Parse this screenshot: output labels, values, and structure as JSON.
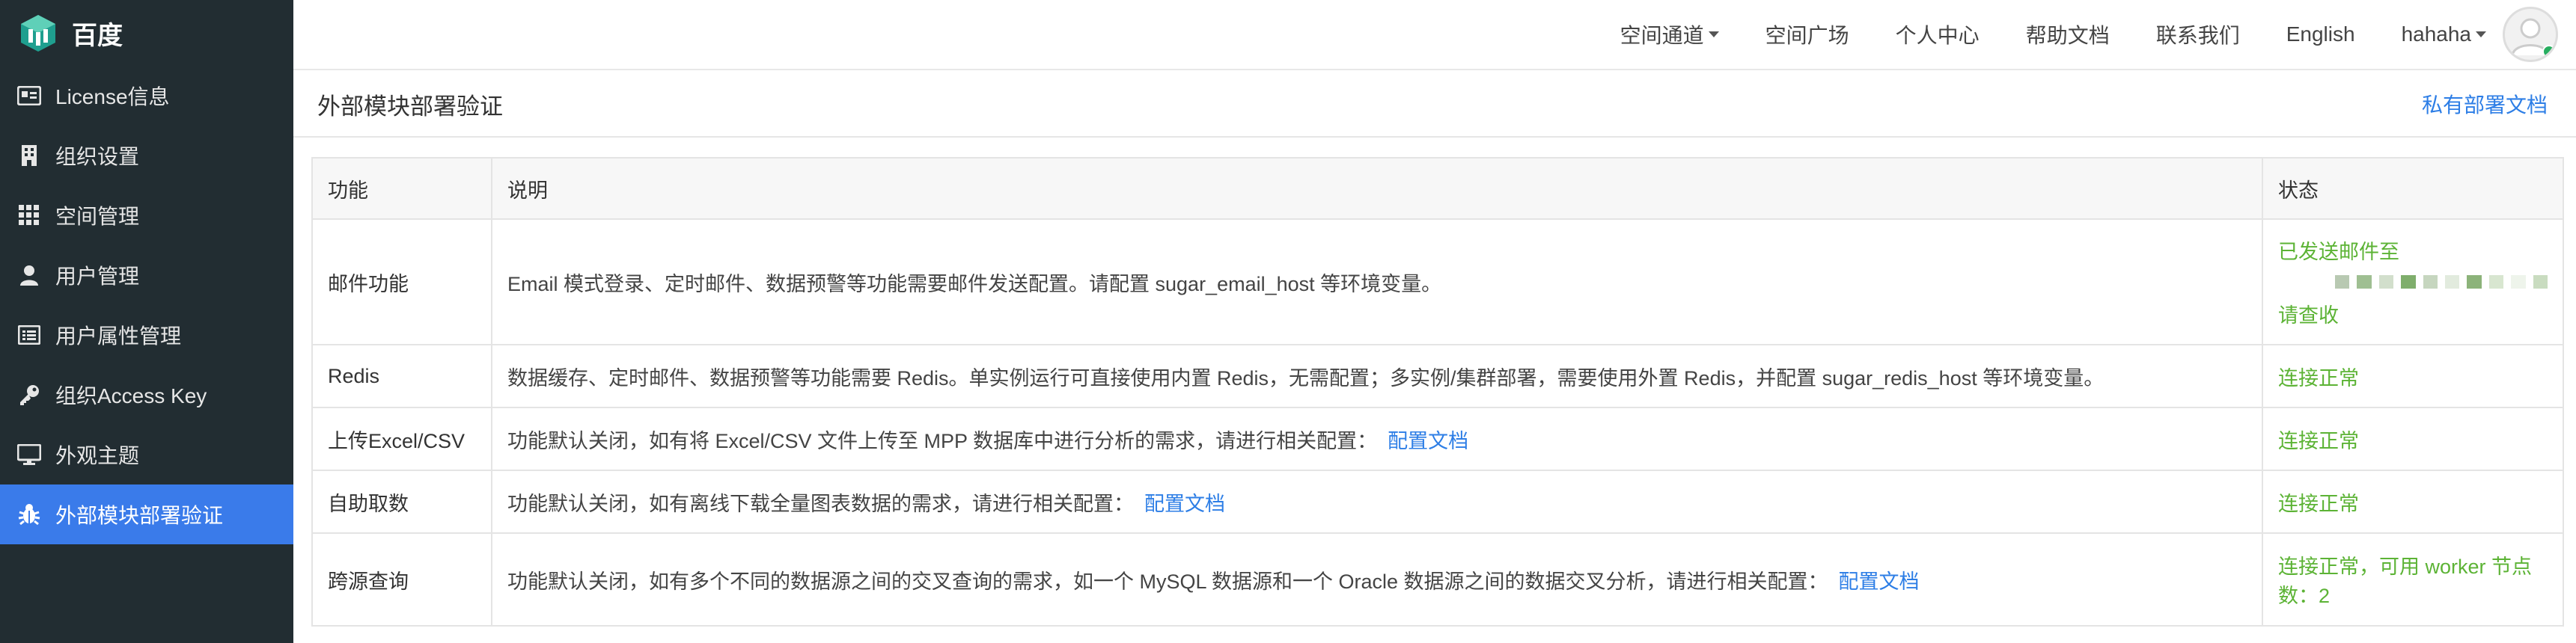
{
  "brand": {
    "name": "百度"
  },
  "sidebar": {
    "items": [
      {
        "label": "License信息",
        "icon": "id-card-icon"
      },
      {
        "label": "组织设置",
        "icon": "building-icon"
      },
      {
        "label": "空间管理",
        "icon": "grid-icon"
      },
      {
        "label": "用户管理",
        "icon": "user-icon"
      },
      {
        "label": "用户属性管理",
        "icon": "list-icon"
      },
      {
        "label": "组织Access Key",
        "icon": "key-icon"
      },
      {
        "label": "外观主题",
        "icon": "monitor-icon"
      },
      {
        "label": "外部模块部署验证",
        "icon": "bug-icon",
        "active": true
      }
    ]
  },
  "topbar": {
    "space_channel": "空间通道",
    "space_square": "空间广场",
    "personal_center": "个人中心",
    "help_docs": "帮助文档",
    "contact_us": "联系我们",
    "language": "English",
    "username": "hahaha"
  },
  "page": {
    "title": "外部模块部署验证",
    "private_deploy_link": "私有部署文档"
  },
  "table": {
    "headers": {
      "feature": "功能",
      "description": "说明",
      "status": "状态"
    },
    "rows": [
      {
        "feature": "邮件功能",
        "description": "Email 模式登录、定时邮件、数据预警等功能需要邮件发送配置。请配置 sugar_email_host 等环境变量。",
        "status_line1": "已发送邮件至",
        "status_line2": "请查收"
      },
      {
        "feature": "Redis",
        "description": "数据缓存、定时邮件、数据预警等功能需要 Redis。单实例运行可直接使用内置 Redis，无需配置；多实例/集群部署，需要使用外置 Redis，并配置 sugar_redis_host 等环境变量。",
        "status": "连接正常"
      },
      {
        "feature": "上传Excel/CSV",
        "description": "功能默认关闭，如有将 Excel/CSV 文件上传至 MPP 数据库中进行分析的需求，请进行相关配置：",
        "link": "配置文档",
        "status": "连接正常"
      },
      {
        "feature": "自助取数",
        "description": "功能默认关闭，如有离线下载全量图表数据的需求，请进行相关配置：",
        "link": "配置文档",
        "status": "连接正常"
      },
      {
        "feature": "跨源查询",
        "description": "功能默认关闭，如有多个不同的数据源之间的交叉查询的需求，如一个 MySQL 数据源和一个 Oracle 数据源之间的数据交叉分析，请进行相关配置：",
        "link": "配置文档",
        "status": "连接正常，可用 worker 节点数：2"
      }
    ]
  },
  "colors": {
    "sidebar_bg": "#222d32",
    "active_bg": "#3a7bea",
    "link": "#2d7ee6",
    "ok": "#5cb335"
  }
}
